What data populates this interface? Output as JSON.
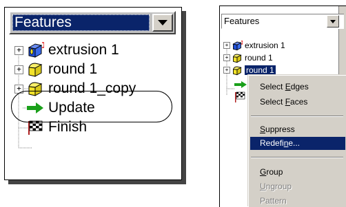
{
  "left": {
    "combo_value": "Features",
    "tree": [
      {
        "label": "extrusion 1",
        "icon": "extrusion-icon",
        "expander": "+"
      },
      {
        "label": "round 1",
        "icon": "round-feature-icon",
        "expander": "+"
      },
      {
        "label": "round 1_copy",
        "icon": "round-feature-icon",
        "expander": "+"
      },
      {
        "label": "Update",
        "icon": "update-arrow-icon",
        "expander": ""
      },
      {
        "label": "Finish",
        "icon": "finish-flag-icon",
        "expander": ""
      }
    ]
  },
  "right": {
    "combo_value": "Features",
    "tree": [
      {
        "label": "extrusion 1",
        "icon": "extrusion-icon",
        "expander": "+"
      },
      {
        "label": "round 1",
        "icon": "round-feature-icon",
        "expander": "+"
      },
      {
        "label": "round 1",
        "icon": "round-feature-icon",
        "expander": "+",
        "selected": true
      }
    ],
    "context_menu": {
      "items": [
        {
          "label": "Select Edges",
          "state": "normal"
        },
        {
          "label": "Select Faces",
          "state": "normal"
        },
        {
          "label": "Suppress",
          "state": "normal"
        },
        {
          "label": "Redefine...",
          "state": "highlighted"
        },
        {
          "label": "Group",
          "state": "normal"
        },
        {
          "label": "Ungroup",
          "state": "disabled"
        },
        {
          "label": "Pattern",
          "state": "disabled"
        }
      ]
    }
  },
  "colors": {
    "selection": "#0a246a",
    "menu_face": "#d4d0c8",
    "extrusion_blue": "#1f4fd8",
    "round_yellow": "#f2e22a",
    "update_green": "#1aa01a"
  }
}
